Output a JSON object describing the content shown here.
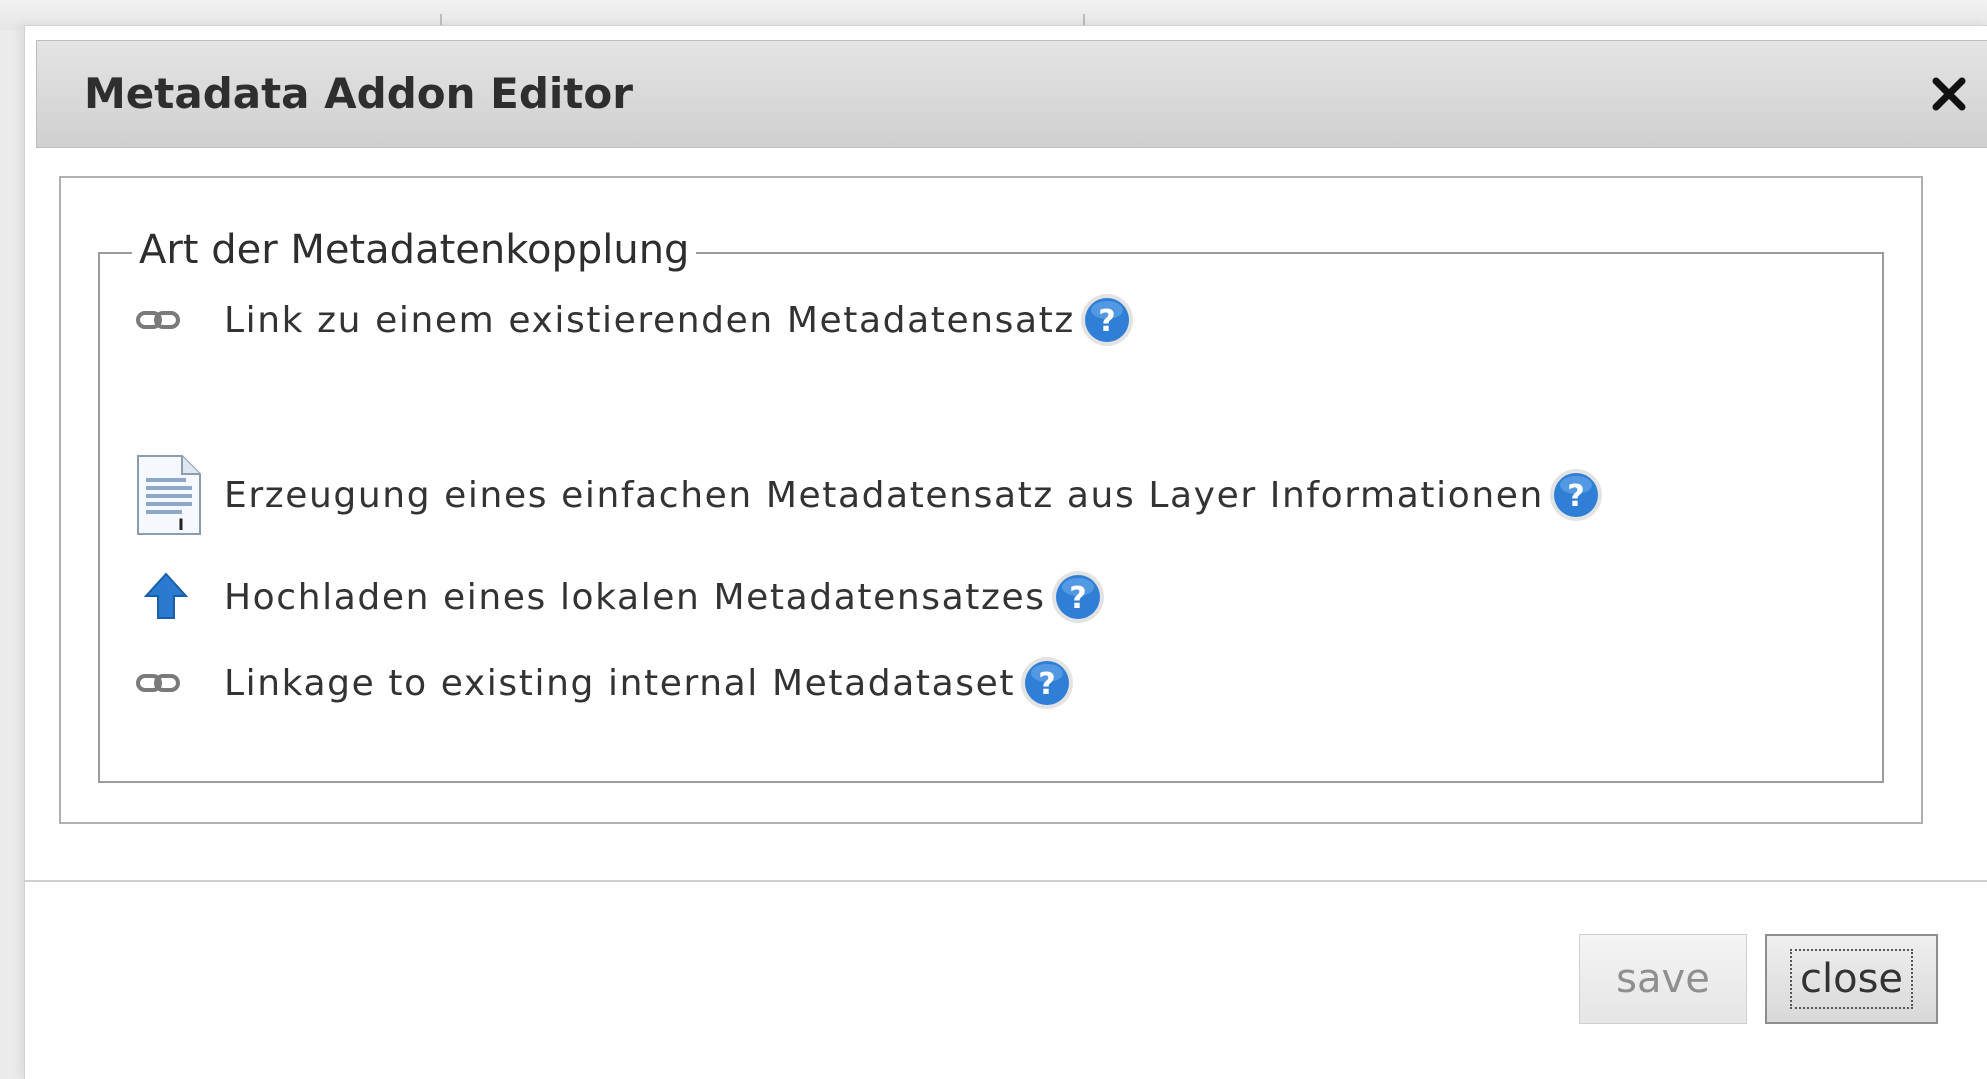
{
  "dialog": {
    "title": "Metadata Addon Editor",
    "close_icon": "close-icon"
  },
  "fieldset": {
    "legend": "Art der Metadatenkopplung",
    "options": [
      {
        "icon": "chain-link-icon",
        "label": "Link zu einem existierenden Metadatensatz",
        "help_icon": "help-icon"
      },
      {
        "icon": "document-icon",
        "label": "Erzeugung eines einfachen Metadatensatz aus Layer Informationen",
        "help_icon": "help-icon"
      },
      {
        "icon": "upload-arrow-icon",
        "label": "Hochladen eines lokalen Metadatensatzes",
        "help_icon": "help-icon"
      },
      {
        "icon": "chain-link-icon",
        "label": "Linkage to existing internal Metadataset",
        "help_icon": "help-icon"
      }
    ]
  },
  "buttons": {
    "save_label": "save",
    "close_label": "close"
  },
  "colors": {
    "help_blue": "#2f7fd6",
    "upload_blue": "#2a7ad0",
    "title_bar": "#d8d8d8"
  }
}
